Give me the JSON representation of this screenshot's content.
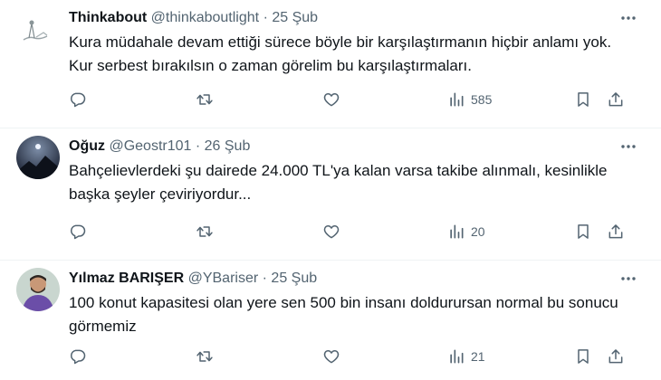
{
  "tweets": [
    {
      "name": "Thinkabout",
      "handle": "@thinkaboutlight",
      "date": "· 25 Şub",
      "text": "Kura müdahale devam ettiği sürece böyle bir karşılaştırmanın hiçbir anlamı yok. Kur serbest bırakılsın o zaman görelim bu karşılaştırmaları.",
      "views": "585"
    },
    {
      "name": "Oğuz",
      "handle": "@Geostr101",
      "date": "· 26 Şub",
      "text": "Bahçelievlerdeki şu dairede 24.000 TL'ya kalan varsa takibe alınmalı, kesinlikle başka şeyler çeviriyordur...",
      "views": "20"
    },
    {
      "name": "Yılmaz BARIŞER",
      "handle": "@YBariser",
      "date": "· 25 Şub",
      "text": "100 konut kapasitesi olan yere sen 500 bin insanı doldurursan normal bu sonucu görmemiz",
      "views": "21"
    }
  ],
  "colors": {
    "text": "#0f1419",
    "secondary": "#536471",
    "divider": "#eff3f4"
  },
  "icons": [
    "reply-icon",
    "retweet-icon",
    "like-icon",
    "views-icon",
    "bookmark-icon",
    "share-icon",
    "more-icon"
  ]
}
